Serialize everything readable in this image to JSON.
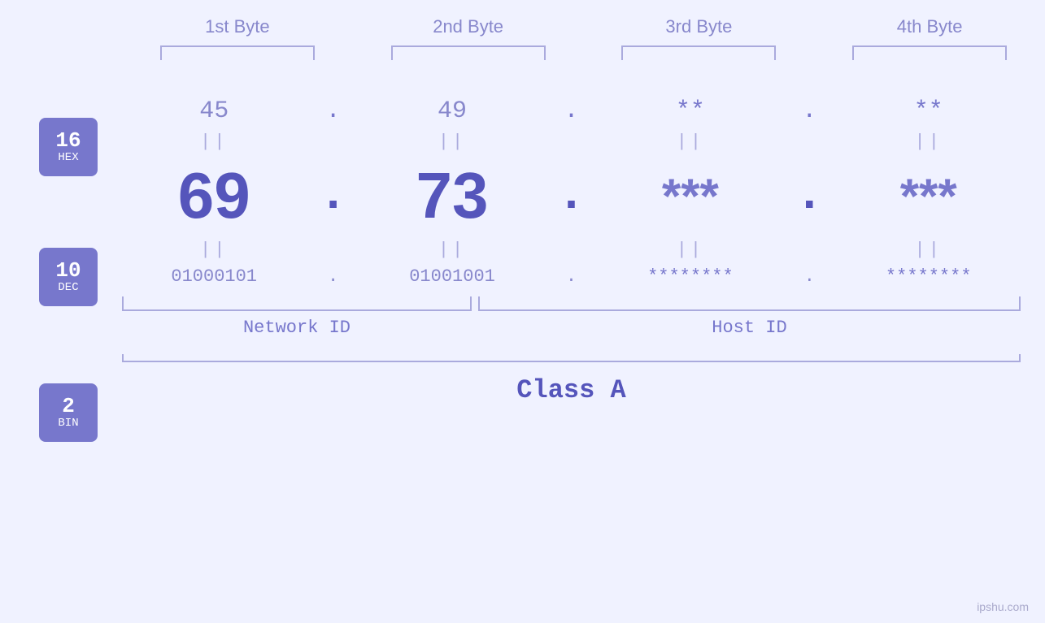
{
  "byteLabels": [
    "1st Byte",
    "2nd Byte",
    "3rd Byte",
    "4th Byte"
  ],
  "badges": [
    {
      "num": "16",
      "label": "HEX",
      "class": "badge-hex"
    },
    {
      "num": "10",
      "label": "DEC",
      "class": "badge-dec"
    },
    {
      "num": "2",
      "label": "BIN",
      "class": "badge-bin"
    }
  ],
  "hexValues": [
    "45",
    "49",
    "**",
    "**"
  ],
  "decValues": [
    "69",
    "73",
    "***",
    "***"
  ],
  "binValues": [
    "01000101",
    "01001001",
    "********",
    "********"
  ],
  "dots": [
    ".",
    ".",
    ".",
    ""
  ],
  "networkId": "Network ID",
  "hostId": "Host ID",
  "classLabel": "Class A",
  "watermark": "ipshu.com",
  "equalsSign": "||"
}
